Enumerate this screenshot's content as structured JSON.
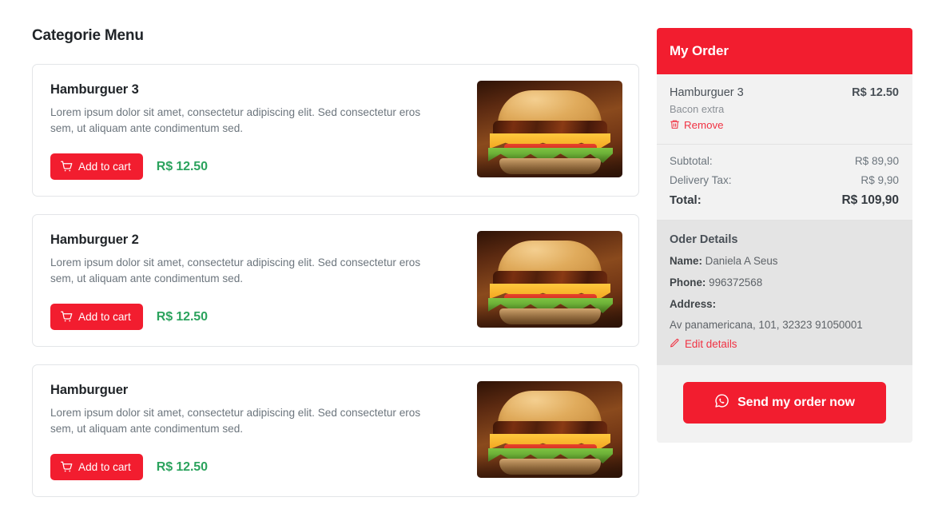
{
  "menu": {
    "title": "Categorie Menu",
    "products": [
      {
        "name": "Hamburguer 3",
        "description": "Lorem ipsum dolor sit amet, consectetur adipiscing elit. Sed consectetur eros sem, ut aliquam ante condimentum sed.",
        "add_label": "Add to cart",
        "price": "R$ 12.50"
      },
      {
        "name": "Hamburguer 2",
        "description": "Lorem ipsum dolor sit amet, consectetur adipiscing elit. Sed consectetur eros sem, ut aliquam ante condimentum sed.",
        "add_label": "Add to cart",
        "price": "R$ 12.50"
      },
      {
        "name": "Hamburguer",
        "description": "Lorem ipsum dolor sit amet, consectetur adipiscing elit. Sed consectetur eros sem, ut aliquam ante condimentum sed.",
        "add_label": "Add to cart",
        "price": "R$ 12.50"
      }
    ]
  },
  "order": {
    "header": "My Order",
    "items": [
      {
        "name": "Hamburguer 3",
        "price": "R$ 12.50",
        "extra": "Bacon extra",
        "remove_label": "Remove"
      }
    ],
    "totals": [
      {
        "label": "Subtotal:",
        "value": "R$ 89,90"
      },
      {
        "label": "Delivery Tax:",
        "value": "R$ 9,90"
      },
      {
        "label": "Total:",
        "value": "R$ 109,90"
      }
    ],
    "details": {
      "title": "Oder Details",
      "name_label": "Name:",
      "name_value": "Daniela A Seus",
      "phone_label": "Phone:",
      "phone_value": "996372568",
      "address_label": "Address:",
      "address_value": "Av panamericana, 101, 32323 91050001",
      "edit_label": "Edit details"
    },
    "send_label": "Send my order now"
  },
  "colors": {
    "brand_red": "#f21d2f",
    "price_green": "#2ba35d",
    "panel_bg": "#f2f2f2",
    "details_bg": "#e4e4e4"
  }
}
